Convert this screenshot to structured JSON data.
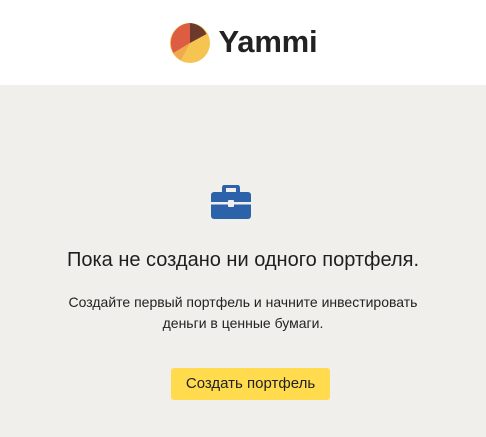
{
  "header": {
    "brand_name": "Yammi",
    "logo_icon": "yammi-logo-icon"
  },
  "empty_state": {
    "icon": "briefcase-icon",
    "title": "Пока не создано ни одного портфеля.",
    "description_line_1": "Создайте первый портфель и начните инвестировать",
    "description_line_2": "деньги в ценные бумаги."
  },
  "actions": {
    "create_portfolio_label": "Создать портфель"
  },
  "colors": {
    "background": "#f1efeb",
    "header": "#ffffff",
    "button": "#ffdb4d",
    "icon_blue": "#2b62aa",
    "logo_red": "#dd5d43",
    "logo_yellow": "#f5c451",
    "logo_brown": "#6b3a2c"
  }
}
